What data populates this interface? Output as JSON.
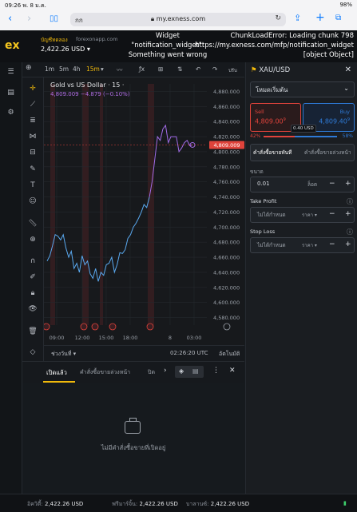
{
  "status_bar": {
    "time": "09:26",
    "date": "พ. 8 ม.ค.",
    "battery": "98%"
  },
  "browser": {
    "tab_text": "กก",
    "url": "my.exness.com"
  },
  "account": {
    "type": "บัญชีทดลอง",
    "domain": "forexonapp.com",
    "balance": "2,422.26 USD"
  },
  "errors": {
    "widget": "Widget \"notification_widget\": Something went wrong",
    "chunk": "ChunkLoadError: Loading chunk 798 https://my.exness.com/mfp/notification_widget [object Object]"
  },
  "chart_toolbar": {
    "timeframes": [
      "1m",
      "5m",
      "4h",
      "15m"
    ],
    "active": "15m",
    "right_label": "ปรับ"
  },
  "chart": {
    "title": "Gold vs US Dollar · 15 ·",
    "subtitle": "4,809.009  −4.879 (−0.10%)",
    "price_tag": "4,809.009",
    "x_labels": [
      "09:00",
      "12:00",
      "15:00",
      "18:00",
      "8",
      "03:00"
    ],
    "y_labels": [
      "4,880.000",
      "4,860.000",
      "4,840.000",
      "4,820.000",
      "4,800.000",
      "4,780.000",
      "4,760.000",
      "4,740.000",
      "4,720.000",
      "4,700.000",
      "4,680.000",
      "4,660.000",
      "4,640.000",
      "4,620.000",
      "4,600.000",
      "4,580.000"
    ],
    "period_label": "ช่วงวันที่",
    "clock": "02:26:20 UTC",
    "auto_label": "อัตโนมัติ"
  },
  "chart_data": {
    "type": "line",
    "ylim": [
      4570,
      4890
    ],
    "series": [
      {
        "color": "#5aa9f0",
        "y": [
          4655,
          4662,
          4675,
          4690,
          4688,
          4683,
          4690,
          4672,
          4660,
          4668,
          4645,
          4652,
          4640,
          4662,
          4650,
          4655,
          4638,
          4632,
          4645,
          4628,
          4640,
          4636,
          4650,
          4652,
          4660,
          4640,
          4650,
          4666,
          4665,
          4670,
          4685,
          4690,
          4700,
          4705,
          4712,
          4720,
          4730,
          4726,
          4740
        ]
      },
      {
        "color": "#a26ce8",
        "y": [
          4740,
          4760,
          4790,
          4820,
          4815,
          4830,
          4835,
          4812,
          4820,
          4820,
          4820,
          4800,
          4805,
          4812,
          4815,
          4808,
          4809
        ]
      }
    ]
  },
  "order_panel": {
    "symbol": "XAU/USD",
    "mode": "โหมดเริ่มต้น",
    "sell_label": "Sell",
    "sell_price": "4,809.00",
    "sell_sup": "9",
    "buy_label": "Buy",
    "buy_price": "4,809.40",
    "buy_sup": "9",
    "spread": "0.40 USD",
    "sentiment_sell": "42%",
    "sentiment_buy": "58%",
    "sentiment_buy_fraction": 0.58,
    "tab_market": "คำสั่งซื้อขายทันที",
    "tab_pending": "คำสั่งซื้อขายล่วงหน้า",
    "volume_label": "ขนาด",
    "volume_value": "0.01",
    "volume_unit": "ล็อต",
    "tp_label": "Take Profit",
    "tp_value": "ไม่ได้กำหนด",
    "tp_unit": "ราคา",
    "sl_label": "Stop Loss",
    "sl_value": "ไม่ได้กำหนด",
    "sl_unit": "ราคา"
  },
  "positions": {
    "tab_open": "เปิดแล้ว",
    "tab_pending": "คำสั่งซื้อขายล่วงหน้า",
    "tab_closed": "ปิด",
    "empty_text": "ไม่มีคำสั่งซื้อขายที่เปิดอยู่"
  },
  "footer": {
    "equity_label": "อิควิตี้:",
    "equity": "2,422.26 USD",
    "free_margin_label": "ฟรีมาร์จิ้น:",
    "free_margin": "2,422.26 USD",
    "balance_label": "บาลานซ์:",
    "balance": "2,422.26 USD"
  },
  "colors": {
    "buy": "#2e7ad6",
    "sell": "#e0433b",
    "accent": "#f0b90b",
    "line_blue": "#5aa9f0",
    "line_purple": "#a26ce8"
  }
}
